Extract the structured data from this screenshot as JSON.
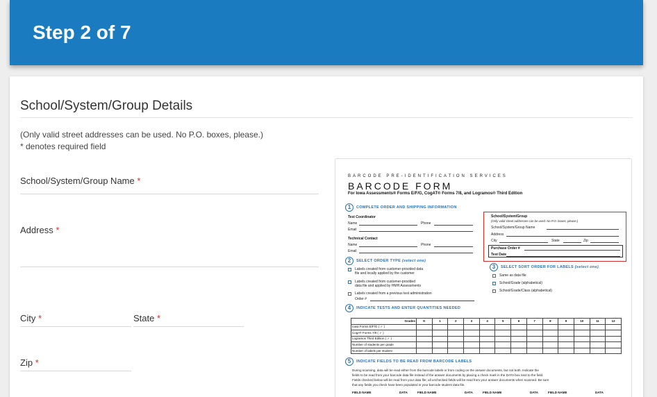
{
  "header": {
    "step_title": "Step 2 of 7"
  },
  "form": {
    "section_title": "School/System/Group Details",
    "note_address": "(Only valid street addresses can be used. No P.O. boxes, please.)",
    "note_required": "* denotes required field",
    "required_mark": "*",
    "fields": {
      "name": {
        "label": "School/System/Group Name"
      },
      "address": {
        "label": "Address"
      },
      "city": {
        "label": "City"
      },
      "state": {
        "label": "State"
      },
      "zip": {
        "label": "Zip"
      }
    }
  },
  "preview": {
    "kicker": "BARCODE PRE-IDENTIFICATION SERVICES",
    "title": "BARCODE FORM",
    "subtitle": "For Iowa Assessments® Forms E/F/G, CogAT® Forms 7/8, and Logramos® Third Edition",
    "s1": {
      "num": "1",
      "heading": "COMPLETE ORDER AND SHIPPING INFORMATION"
    },
    "test_coordinator": "Test Coordinator",
    "technical_contact": "Technical Contact",
    "name": "Name",
    "phone": "Phone",
    "email": "Email",
    "box": {
      "heading": "School/System/Group",
      "note": "(Only valid street addresses can be used. No P.O. boxes, please.)",
      "name": "School/System/Group Name",
      "address": "Address",
      "city": "City",
      "state": "State",
      "zip": "Zip",
      "po": "Purchase Order #",
      "test_date": "Test Date"
    },
    "s2": {
      "num": "2",
      "heading": "SELECT ORDER TYPE",
      "hint": "(select one)",
      "opt1a": "Labels created from customer-provided data",
      "opt1b": "file and locally applied by the customer",
      "opt2a": "Labels created from customer-provided",
      "opt2b": "data file and applied by HMH Assessments",
      "opt3": "Labels created from a previous test administration",
      "order": "Order #"
    },
    "s3": {
      "num": "3",
      "heading": "SELECT SORT ORDER FOR LABELS",
      "hint": "(select one)",
      "opt1": "Same as data file",
      "opt2": "School/Grade (alphabetical)",
      "opt3": "School/Grade/Class (alphabetical)"
    },
    "s4": {
      "num": "4",
      "heading": "INDICATE TESTS AND ENTER QUANTITIES NEEDED",
      "grades_label": "Grades",
      "grades": [
        "K",
        "1",
        "2",
        "3",
        "4",
        "5",
        "6",
        "7",
        "8",
        "9",
        "10",
        "11",
        "12"
      ],
      "rows": [
        "Iowa Forms E/F/G  ( ✓ )",
        "CogAT Forms 7/8  ( ✓ )",
        "Logramos Third Edition ( ✓ )",
        "Number of students per grade",
        "Number of labels per student"
      ]
    },
    "s5": {
      "num": "5",
      "heading": "INDICATE FIELDS TO BE READ FROM BARCODE LABELS",
      "p1": "During scanning, data will be read either from the barcode labels or from coding on the answer documents, but not both. Indicate the",
      "p2": "fields to be read from your barcode data file instead of the answer documents by placing a check mark in the DATA box next to the field.",
      "p3": "Fields checked below will be read from your data file; all unchecked fields will be read from your answer documents when scanned. Be sure",
      "p4": "that any fields you check have been populated in your barcode student data file.",
      "field_name": "FIELD NAME",
      "data": "DATA"
    }
  }
}
